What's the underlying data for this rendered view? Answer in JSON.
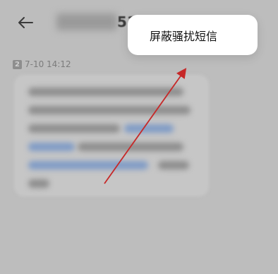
{
  "header": {
    "back_icon": "back-arrow-icon",
    "contact_visible_suffix": "51"
  },
  "message": {
    "sim_slot": "2",
    "timestamp": "7-10 14:12"
  },
  "popup_menu": {
    "items": [
      {
        "label": "屏蔽骚扰短信"
      }
    ]
  },
  "colors": {
    "overlay_background": "#bdbdbd",
    "popup_background": "#ffffff",
    "annotation_arrow": "#c62828",
    "link_blur": "#7f9bc6"
  }
}
